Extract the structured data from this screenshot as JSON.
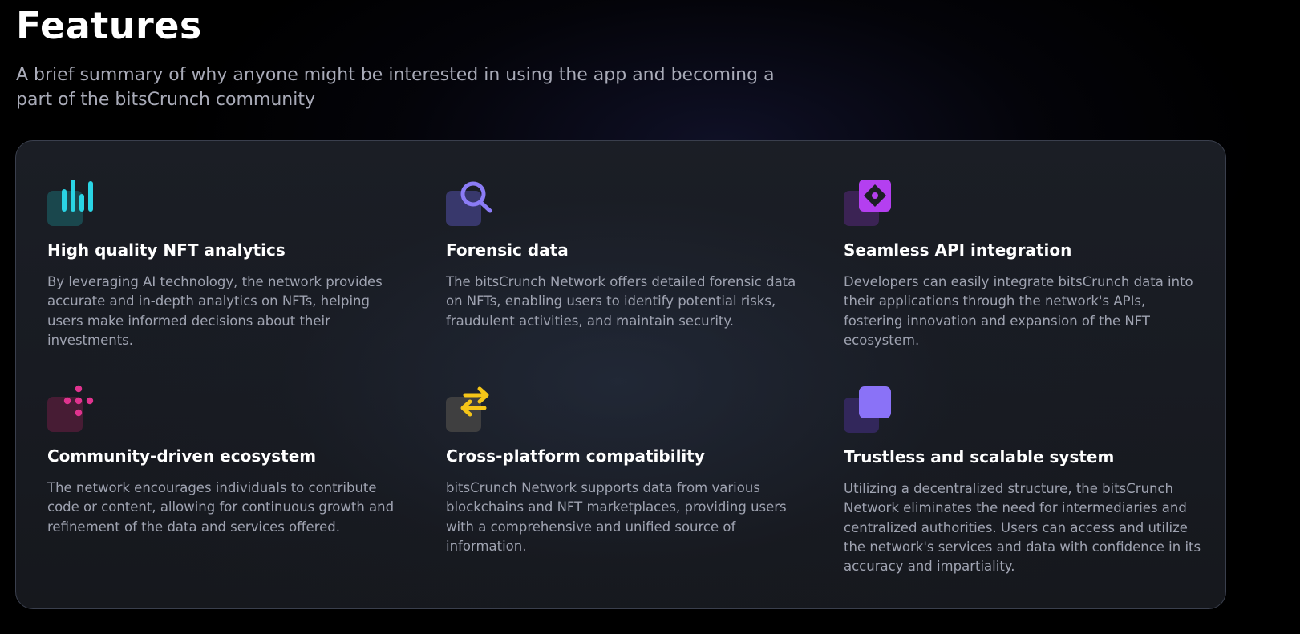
{
  "header": {
    "title": "Features",
    "subtitle": "A brief summary of why anyone might be interested in using the app and becoming a part of the bitsCrunch community"
  },
  "features": [
    {
      "icon": "bar-chart-icon",
      "accent": "#2ad4e4",
      "title": "High quality NFT analytics",
      "description": "By leveraging AI technology, the network provides accurate and in-depth analytics on NFTs, helping users make informed decisions about their investments."
    },
    {
      "icon": "search-icon",
      "accent": "#8b7cf6",
      "title": "Forensic data",
      "description": "The bitsCrunch Network offers detailed forensic data on NFTs, enabling users to identify potential risks, fraudulent activities, and maintain security."
    },
    {
      "icon": "api-diamond-icon",
      "accent": "#b43ff0",
      "title": "Seamless API integration",
      "description": "Developers can easily integrate bitsCrunch data into their applications through the network's APIs, fostering innovation and expansion of the NFT ecosystem."
    },
    {
      "icon": "community-dots-icon",
      "accent": "#e0338f",
      "title": "Community-driven ecosystem",
      "description": "The network encourages individuals to contribute code or content, allowing for continuous growth and refinement of the data and services offered."
    },
    {
      "icon": "swap-arrows-icon",
      "accent": "#f5c518",
      "title": "Cross-platform compatibility",
      "description": "bitsCrunch Network supports data from various blockchains and NFT marketplaces, providing users with a comprehensive and unified source of information."
    },
    {
      "icon": "stacked-squares-icon",
      "accent": "#8a72f7",
      "title": "Trustless and scalable system",
      "description": "Utilizing a decentralized structure, the bitsCrunch Network eliminates the need for intermediaries and centralized authorities. Users can access and utilize the network's services and data with confidence in its accuracy and impartiality."
    }
  ]
}
